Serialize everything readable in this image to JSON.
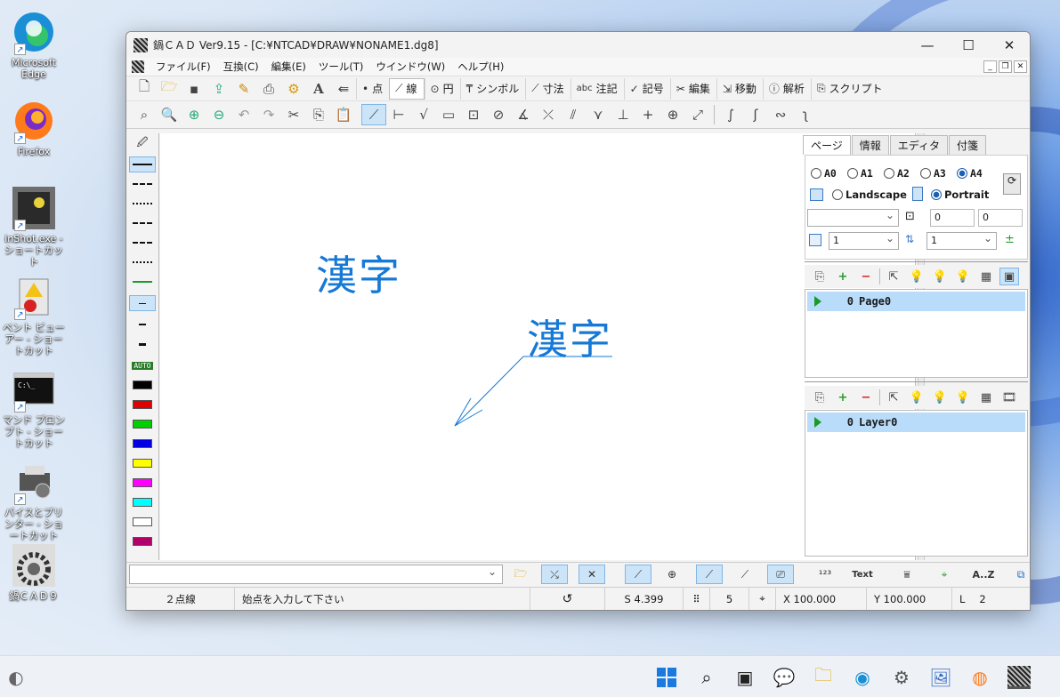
{
  "desktop": {
    "icons": [
      {
        "label": "Microsoft Edge"
      },
      {
        "label": "Firefox"
      },
      {
        "label": "inShot.exe - ショートカット"
      },
      {
        "label": "ベント ビューアー - ショートカット"
      },
      {
        "label": "マンド プロンプト - ショートカット"
      },
      {
        "label": "バイスとプリンター - ショートカット"
      },
      {
        "label": "鍋ＣＡＤ９"
      }
    ]
  },
  "window": {
    "title": "鍋ＣＡＤ Ver9.15 - [C:¥NTCAD¥DRAW¥NONAME1.dg8]",
    "controls": {
      "minimize": "—",
      "maximize": "☐",
      "close": "✕"
    }
  },
  "menu": [
    "ファイル(F)",
    "互換(C)",
    "編集(E)",
    "ツール(T)",
    "ウインドウ(W)",
    "ヘルプ(H)"
  ],
  "modes": [
    {
      "glyph": "•",
      "label": "点"
    },
    {
      "glyph": "⟋",
      "label": "線"
    },
    {
      "glyph": "⊙",
      "label": "円"
    },
    {
      "glyph": "₸",
      "label": "シンボル"
    },
    {
      "glyph": "⟋",
      "label": "寸法"
    },
    {
      "glyph": "abc",
      "label": "注記"
    },
    {
      "glyph": "✓",
      "label": "記号"
    },
    {
      "glyph": "✂",
      "label": "編集"
    },
    {
      "glyph": "⇲",
      "label": "移動"
    },
    {
      "glyph": "ⓘ",
      "label": "解析"
    },
    {
      "glyph": "⎘",
      "label": "スクリプト"
    }
  ],
  "canvas": {
    "text1": "漢字",
    "text2": "漢字"
  },
  "palette": {
    "auto_label": "AUTO",
    "colors": [
      "#000000",
      "#e00000",
      "#00d000",
      "#0000e0",
      "#ffff00",
      "#ff00ff",
      "#00ffff",
      "#ffffff",
      "#b0006a"
    ]
  },
  "panel": {
    "tabs": [
      "ページ",
      "情報",
      "エディタ",
      "付箋"
    ],
    "paper_sizes": [
      "A0",
      "A1",
      "A2",
      "A3",
      "A4"
    ],
    "selected_paper": "A4",
    "orientation": [
      "Landscape",
      "Portrait"
    ],
    "selected_orientation": "Portrait",
    "offset_x": "0",
    "offset_y": "0",
    "scale1": "1",
    "scale2": "1",
    "page_list": [
      {
        "num": "0",
        "name": "Page0"
      }
    ],
    "layer_list": [
      {
        "num": "0",
        "name": "Layer0"
      }
    ]
  },
  "cmdbar": {
    "text_label": "Text",
    "az_label": "A..Z"
  },
  "status": {
    "linetype": "２点線",
    "prompt": "始点を入力して下さい",
    "snap": "S 4.399",
    "grid": "5",
    "x": "X 100.000",
    "y": "Y 100.000",
    "layer_label": "L",
    "layer_num": "2"
  }
}
